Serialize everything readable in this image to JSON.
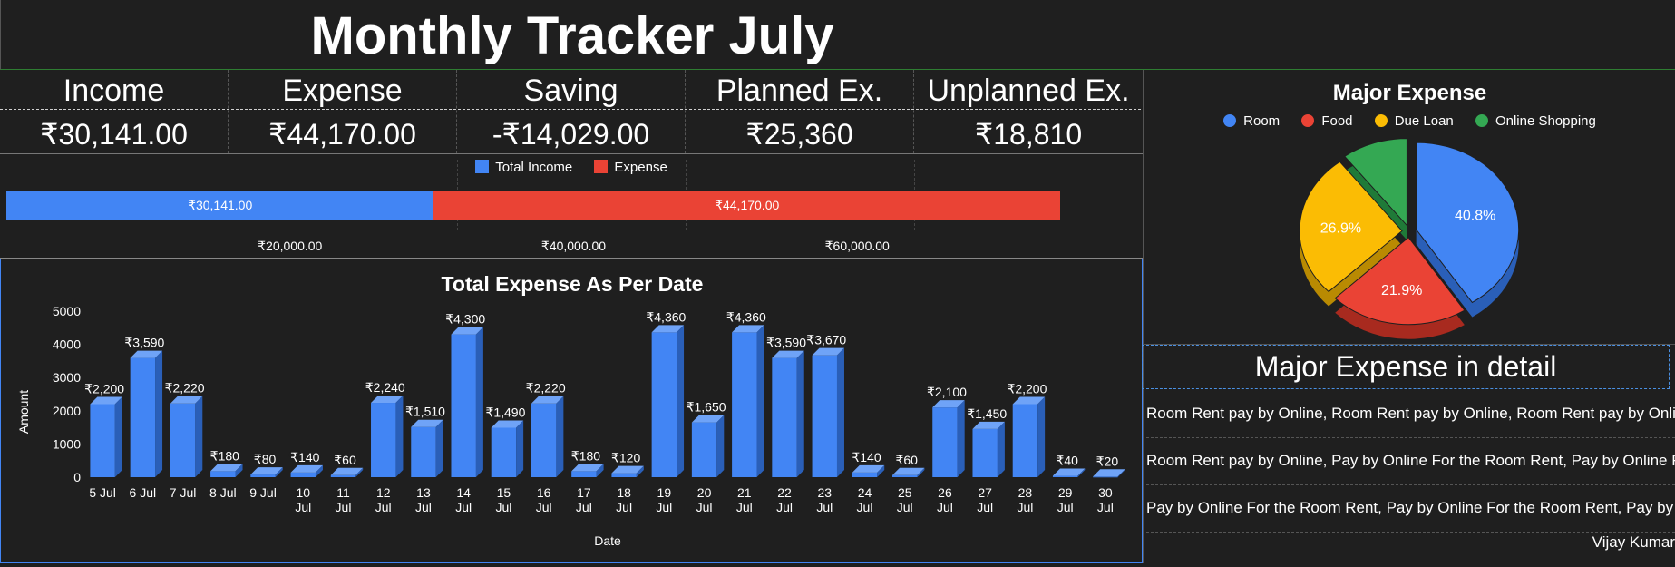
{
  "header": {
    "title": "Monthly Tracker July"
  },
  "summary": [
    {
      "label": "Income",
      "value": "₹30,141.00"
    },
    {
      "label": "Expense",
      "value": "₹44,170.00"
    },
    {
      "label": "Saving",
      "value": "-₹14,029.00"
    },
    {
      "label": "Planned Ex.",
      "value": "₹25,360"
    },
    {
      "label": "Unplanned Ex.",
      "value": "₹18,810"
    }
  ],
  "income_expense_bar": {
    "legend": [
      {
        "name": "Total Income",
        "color": "#4285f4"
      },
      {
        "name": "Expense",
        "color": "#ea4335"
      }
    ],
    "segments": [
      {
        "label": "₹30,141.00",
        "value": 30141,
        "color": "#4285f4"
      },
      {
        "label": "₹44,170.00",
        "value": 44170,
        "color": "#ea4335"
      }
    ],
    "axis_ticks": [
      {
        "label": "₹20,000.00",
        "value": 20000
      },
      {
        "label": "₹40,000.00",
        "value": 40000
      },
      {
        "label": "₹60,000.00",
        "value": 60000
      }
    ],
    "axis_max": 80000
  },
  "chart_data": [
    {
      "type": "bar",
      "title": "Total Expense As Per Date",
      "xlabel": "Date",
      "ylabel": "Amount",
      "ylim": [
        0,
        5000
      ],
      "yticks": [
        0,
        1000,
        2000,
        3000,
        4000,
        5000
      ],
      "color": "#4285f4",
      "categories": [
        "5 Jul",
        "6 Jul",
        "7 Jul",
        "8 Jul",
        "9 Jul",
        "10 Jul",
        "11 Jul",
        "12 Jul",
        "13 Jul",
        "14 Jul",
        "15 Jul",
        "16 Jul",
        "17 Jul",
        "18 Jul",
        "19 Jul",
        "20 Jul",
        "21 Jul",
        "22 Jul",
        "23 Jul",
        "24 Jul",
        "25 Jul",
        "26 Jul",
        "27 Jul",
        "28 Jul",
        "29 Jul",
        "30 Jul"
      ],
      "values": [
        2200,
        3590,
        2220,
        180,
        80,
        140,
        60,
        2240,
        1510,
        4300,
        1490,
        2220,
        180,
        120,
        4360,
        1650,
        4360,
        3590,
        3670,
        140,
        60,
        2100,
        1450,
        2200,
        40,
        20
      ],
      "data_labels": [
        "₹2,200",
        "₹3,590",
        "₹2,220",
        "₹180",
        "₹80",
        "₹140",
        "₹60",
        "₹2,240",
        "₹1,510",
        "₹4,300",
        "₹1,490",
        "₹2,220",
        "₹180",
        "₹120",
        "₹4,360",
        "₹1,650",
        "₹4,360",
        "₹3,590",
        "₹3,670",
        "₹140",
        "₹60",
        "₹2,100",
        "₹1,450",
        "₹2,200",
        "₹40",
        "₹20"
      ]
    },
    {
      "type": "pie",
      "title": "Major Expense",
      "legend_placement": "top",
      "categories": [
        "Room",
        "Food",
        "Due Loan",
        "Online Shopping"
      ],
      "colors": [
        "#4285f4",
        "#ea4335",
        "#fbbc04",
        "#34a853"
      ],
      "values": [
        40.8,
        21.9,
        26.9,
        10.4
      ],
      "data_labels": [
        "40.8%",
        "21.9%",
        "26.9%",
        ""
      ]
    }
  ],
  "details": {
    "header": "Major Expense in detail",
    "rows": [
      "Room Rent pay by Online, Room Rent pay by Online, Room Rent pay by Online",
      "Room Rent pay by Online, Pay by Online For the Room Rent, Pay by Online For the Room Rent",
      "Pay by Online For the Room Rent, Pay by Online For the Room Rent, Pay by Online For the Room Rent"
    ],
    "author": "Vijay Kumar"
  }
}
